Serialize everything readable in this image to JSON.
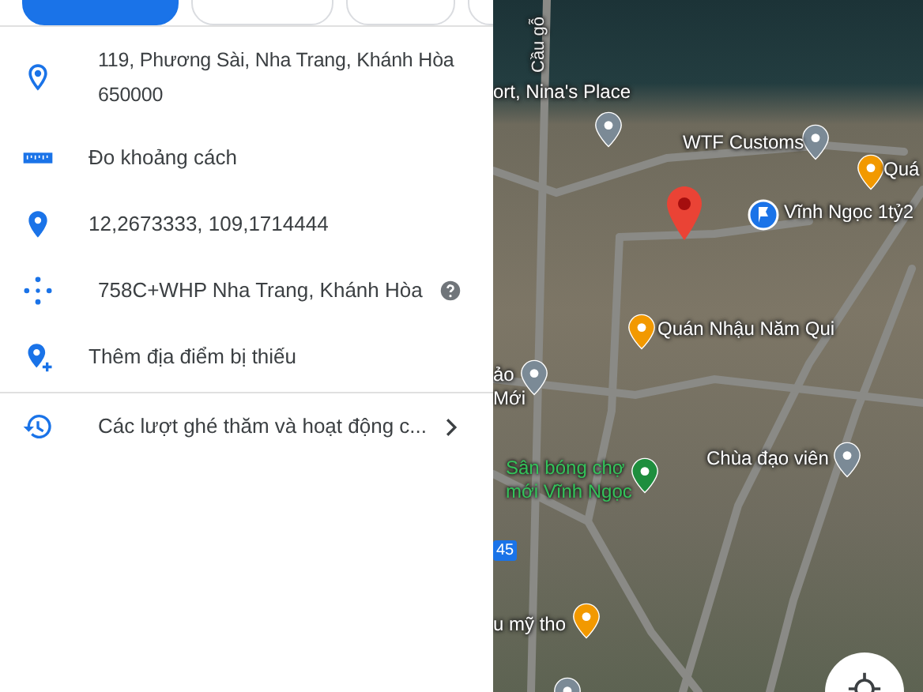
{
  "info_rows": [
    {
      "kind": "address",
      "text": "119, Phương Sài, Nha Trang, Khánh Hòa 650000"
    },
    {
      "kind": "measure",
      "text": "Đo khoảng cách"
    },
    {
      "kind": "coords",
      "text": "12,2673333, 109,1714444"
    },
    {
      "kind": "pluscode",
      "text": "758C+WHP Nha Trang, Khánh Hòa"
    },
    {
      "kind": "add",
      "text": "Thêm địa điểm bị thiếu"
    }
  ],
  "history_row": {
    "text": "Các lượt ghé thăm và hoạt động c..."
  },
  "map_labels": [
    {
      "kind": "road",
      "text": "Cầu gỗ"
    },
    {
      "kind": "place",
      "text": "ort, Nina's Place"
    },
    {
      "kind": "place",
      "text": "WTF Customs"
    },
    {
      "kind": "place",
      "text": "Quá"
    },
    {
      "kind": "place",
      "text": "Vĩnh Ngọc 1tỷ2"
    },
    {
      "kind": "place",
      "text": "Quán Nhậu Năm Qui"
    },
    {
      "kind": "place",
      "text": "ảo\nMới"
    },
    {
      "kind": "green",
      "text": "Sân bóng chợ\nmới Vĩnh Ngọc"
    },
    {
      "kind": "place",
      "text": "Chùa đạo viên"
    },
    {
      "kind": "route",
      "text": "45"
    },
    {
      "kind": "place",
      "text": "u mỹ tho"
    }
  ]
}
